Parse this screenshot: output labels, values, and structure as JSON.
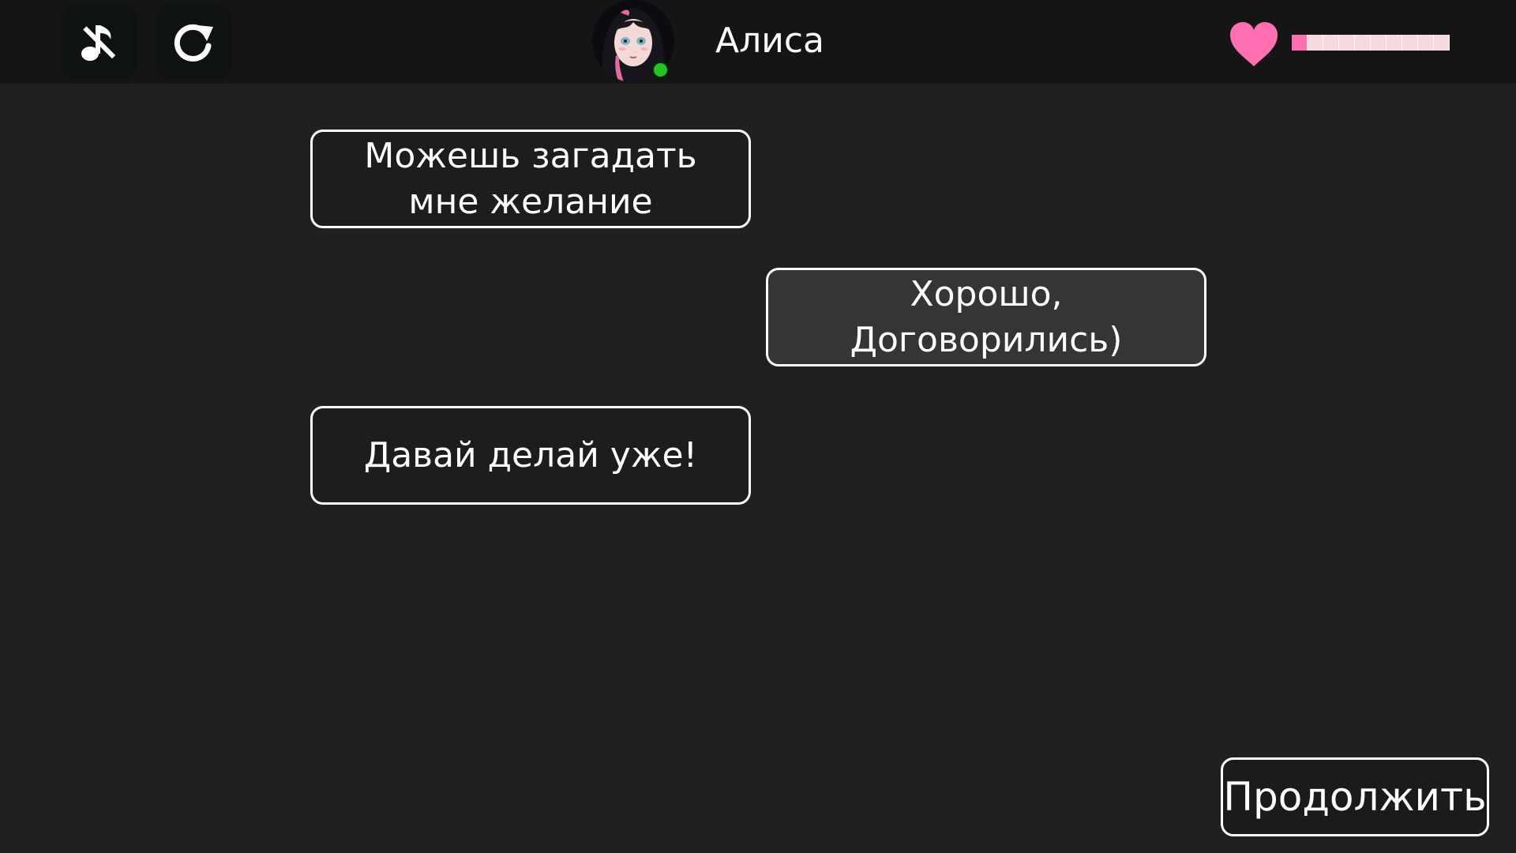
{
  "header": {
    "character_name": "Алиса",
    "status": "online",
    "affection_level": 0.1,
    "colors": {
      "heart": "#ff6fb2",
      "bar_fill": "#ff6fb2",
      "bar_empty": "#f7d9e0",
      "online": "#23c423"
    },
    "icons": {
      "mute": "music-off-icon",
      "restart": "restart-icon",
      "affection": "heart-icon"
    }
  },
  "messages": [
    {
      "side": "left",
      "text": "Можешь загадать мне желание"
    },
    {
      "side": "right",
      "text": "Хорошо, Договорились)"
    },
    {
      "side": "left",
      "text": "Давай делай уже!"
    }
  ],
  "continue_button": {
    "label": "Продолжить"
  }
}
